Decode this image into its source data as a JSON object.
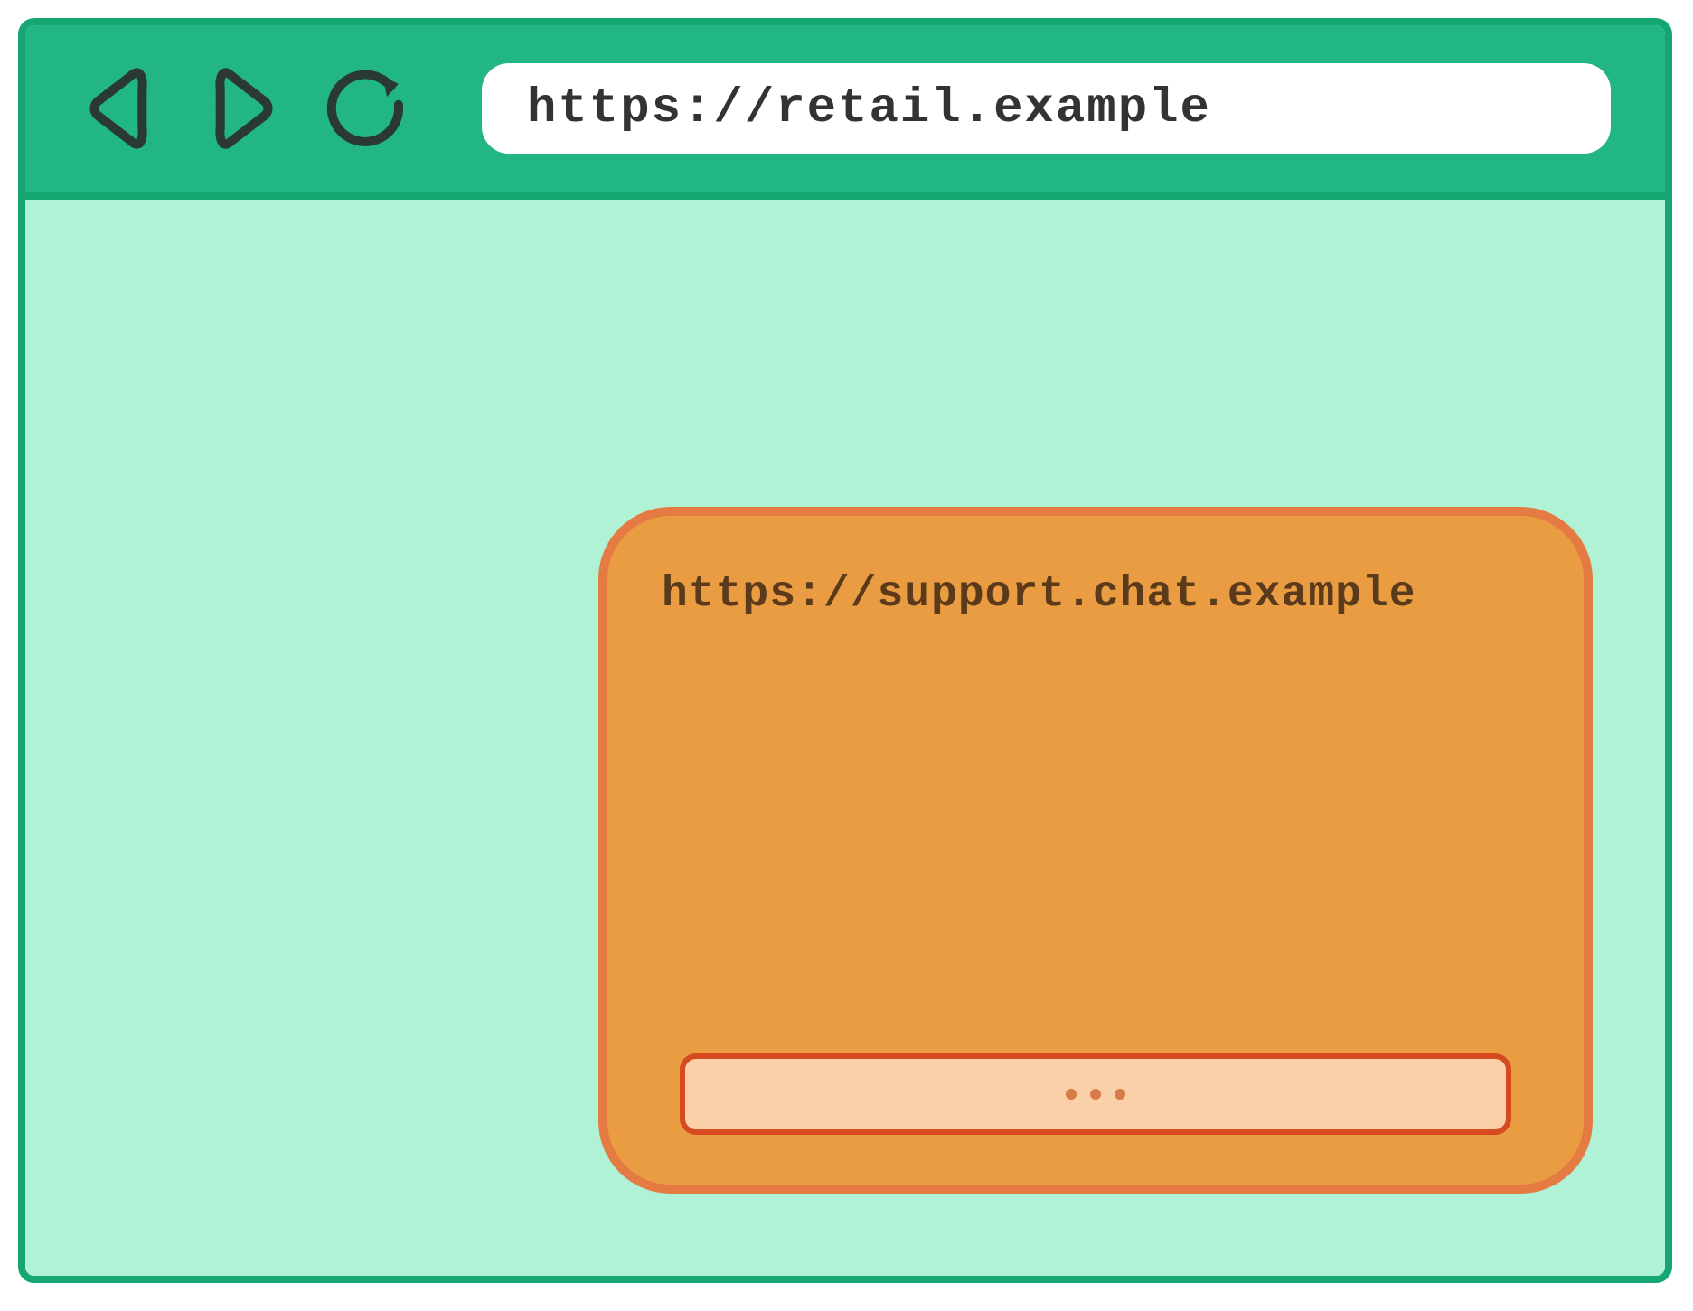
{
  "toolbar": {
    "url": "https://retail.example"
  },
  "chat": {
    "url": "https://support.chat.example"
  },
  "colors": {
    "toolbar_bg": "#21b683",
    "border": "#16a671",
    "content_bg": "#b0f2d6",
    "chat_bg": "#ea9c42",
    "chat_border": "#e57b42",
    "chat_input_bg": "#f9d0a8",
    "chat_input_border": "#d54a1f"
  }
}
